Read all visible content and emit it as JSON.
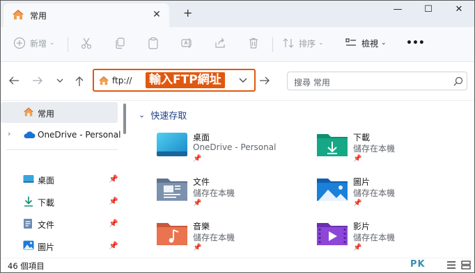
{
  "tab": {
    "title": "常用",
    "close_glyph": "✕",
    "new_tab_glyph": "+"
  },
  "window_controls": {
    "minimize": "—",
    "maximize": "☐",
    "close": "✕"
  },
  "command_bar": {
    "new_label": "新增",
    "sort_label": "排序",
    "view_label": "檢視",
    "more_label": "•••",
    "icons": [
      "plus-circle-icon",
      "cut-icon",
      "copy-icon",
      "paste-icon",
      "rename-icon",
      "share-icon",
      "delete-icon",
      "sort-icon",
      "view-icon",
      "more-icon"
    ]
  },
  "address": {
    "value": "ftp://",
    "annotation": "輸入FTP網址",
    "search_placeholder": "搜尋 常用"
  },
  "sidebar": {
    "items": [
      {
        "label": "常用",
        "icon": "home-icon",
        "selected": true
      },
      {
        "label": "OneDrive - Personal",
        "icon": "cloud-icon"
      },
      {
        "label": "桌面",
        "icon": "desktop-icon",
        "pinned": true
      },
      {
        "label": "下載",
        "icon": "download-icon",
        "pinned": true
      },
      {
        "label": "文件",
        "icon": "document-icon",
        "pinned": true
      },
      {
        "label": "圖片",
        "icon": "pictures-icon",
        "pinned": true
      }
    ]
  },
  "main": {
    "group_title": "快速存取",
    "tiles": [
      {
        "name": "桌面",
        "sub": "OneDrive - Personal",
        "icon": "desktop-folder-icon"
      },
      {
        "name": "下載",
        "sub": "儲存在本機",
        "icon": "downloads-folder-icon"
      },
      {
        "name": "文件",
        "sub": "儲存在本機",
        "icon": "documents-folder-icon"
      },
      {
        "name": "圖片",
        "sub": "儲存在本機",
        "icon": "pictures-folder-icon"
      },
      {
        "name": "音樂",
        "sub": "儲存在本機",
        "icon": "music-folder-icon"
      },
      {
        "name": "影片",
        "sub": "儲存在本機",
        "icon": "videos-folder-icon"
      }
    ]
  },
  "status": {
    "item_count": "46 個項目",
    "watermark": "PK"
  },
  "colors": {
    "accent_orange": "#e0580f",
    "group_blue": "#1f3f8a",
    "watermark_blue": "#3a8db5"
  }
}
